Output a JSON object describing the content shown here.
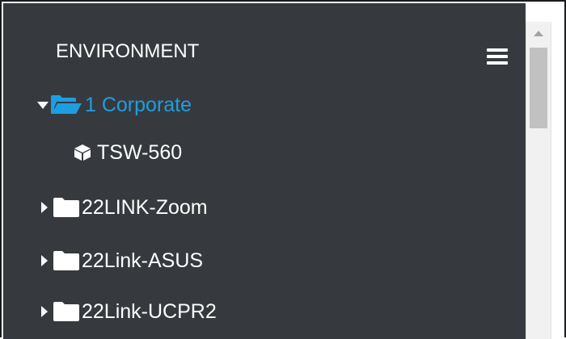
{
  "panel": {
    "title": "ENVIRONMENT",
    "menu_icon": "hamburger-menu-icon"
  },
  "tree": {
    "items": [
      {
        "label": "1 Corporate",
        "icon": "folder-open-icon",
        "expanded": true,
        "selected": true,
        "color": "#1e9ee2"
      },
      {
        "label": "TSW-560",
        "icon": "cube-icon",
        "device": true
      },
      {
        "label": "22LINK-Zoom",
        "icon": "folder-icon",
        "expanded": false
      },
      {
        "label": "22Link-ASUS",
        "icon": "folder-icon",
        "expanded": false
      },
      {
        "label": "22Link-UCPR2",
        "icon": "folder-icon",
        "expanded": false
      }
    ]
  },
  "colors": {
    "panel_bg": "#363a3e",
    "accent": "#1e9ee2",
    "text": "#ffffff"
  }
}
